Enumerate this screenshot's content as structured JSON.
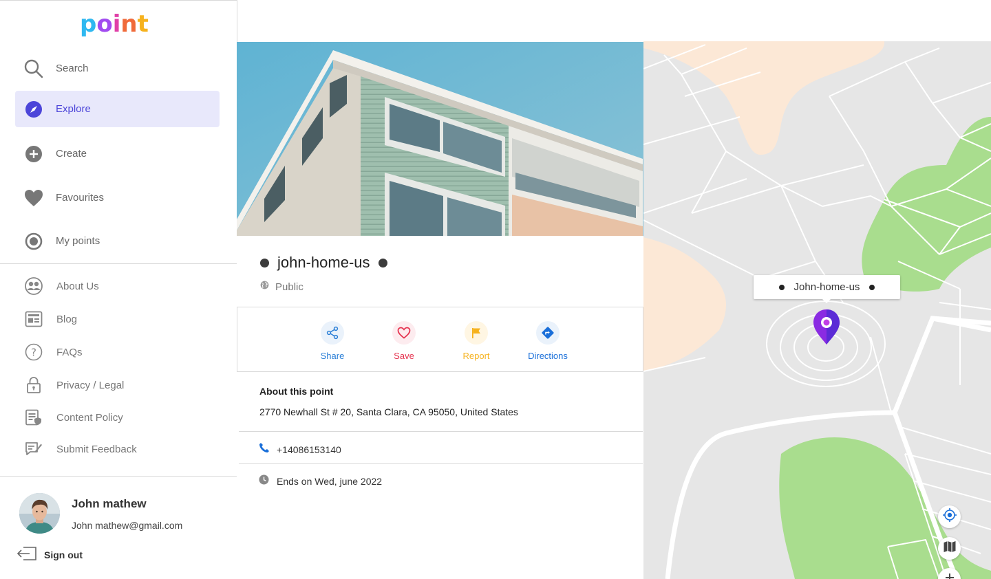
{
  "logo": {
    "text": [
      "p",
      "o",
      "i",
      "n",
      "t"
    ],
    "colors": [
      "#2fb8f0",
      "#a24bf0",
      "#e040a8",
      "#f06a3a",
      "#f6b21e"
    ]
  },
  "nav": {
    "items": [
      {
        "label": "Search",
        "icon": "search-icon"
      },
      {
        "label": "Explore",
        "icon": "compass-icon",
        "active": true
      },
      {
        "label": "Create",
        "icon": "plus-circle-icon"
      },
      {
        "label": "Favourites",
        "icon": "heart-icon"
      },
      {
        "label": "My points",
        "icon": "radio-icon"
      }
    ],
    "links": [
      {
        "label": "About Us",
        "icon": "people-icon"
      },
      {
        "label": "Blog",
        "icon": "blog-icon"
      },
      {
        "label": "FAQs",
        "icon": "question-icon"
      },
      {
        "label": "Privacy / Legal",
        "icon": "lock-icon"
      },
      {
        "label": "Content Policy",
        "icon": "policy-icon"
      },
      {
        "label": "Submit Feedback",
        "icon": "feedback-icon"
      }
    ]
  },
  "user": {
    "name": "John mathew",
    "email": "John mathew@gmail.com",
    "signout_label": "Sign out"
  },
  "point": {
    "title": "john-home-us",
    "visibility": "Public",
    "actions": [
      {
        "label": "Share",
        "color": "#2b7fd6",
        "bg": "#eaf2fb",
        "icon": "share-icon"
      },
      {
        "label": "Save",
        "color": "#e5334f",
        "bg": "#fdecef",
        "icon": "heart-outline-icon"
      },
      {
        "label": "Report",
        "color": "#f6b21e",
        "bg": "#fff6e3",
        "icon": "flag-icon"
      },
      {
        "label": "Directions",
        "color": "#1a6fd9",
        "bg": "#eaf2fb",
        "icon": "directions-icon"
      }
    ],
    "about_title": "About this point",
    "address": "2770 Newhall St # 20, Santa Clara, CA 95050, United States",
    "phone": "+14086153140",
    "ends": "Ends on Wed, june 2022"
  },
  "map": {
    "marker_label": "John-home-us",
    "colors": {
      "park": "#a9dd8e",
      "sand": "#fce8d6",
      "road": "#ffffff",
      "base": "#e6e6e6",
      "marker": "#8a2be2"
    }
  },
  "accent": "#4c45d9"
}
